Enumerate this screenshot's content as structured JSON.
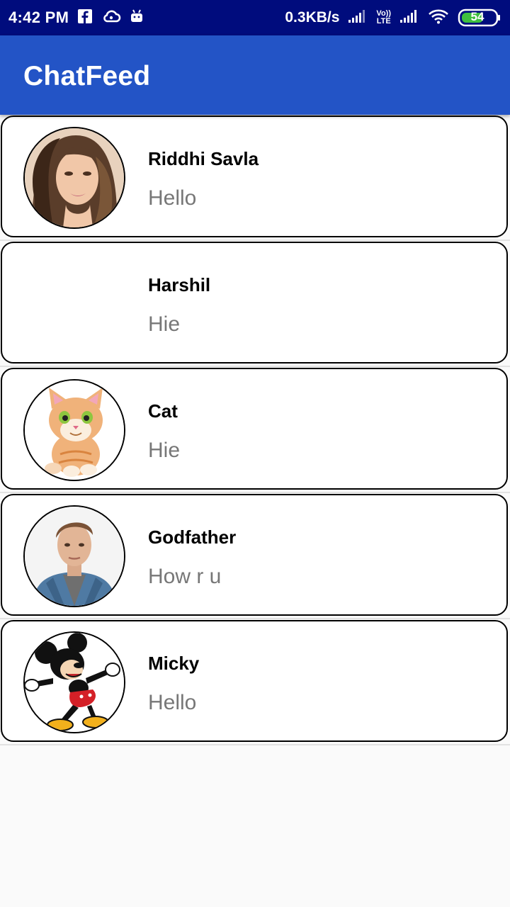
{
  "status_bar": {
    "time": "4:42 PM",
    "net_speed": "0.3KB/s",
    "volte_top": "Vo))",
    "volte_bottom": "LTE",
    "battery": "54",
    "icons": [
      "facebook-icon",
      "cloud-icon",
      "android-icon",
      "signal-icon",
      "volte-icon",
      "signal-icon",
      "wifi-icon",
      "battery-icon"
    ]
  },
  "app_bar": {
    "title": "ChatFeed"
  },
  "chats": [
    {
      "name": "Riddhi Savla",
      "message": "Hello",
      "avatar": "woman-portrait"
    },
    {
      "name": "Harshil",
      "message": "Hie",
      "avatar": "none"
    },
    {
      "name": "Cat",
      "message": "Hie",
      "avatar": "cartoon-cat"
    },
    {
      "name": "Godfather",
      "message": "How r u",
      "avatar": "man-portrait"
    },
    {
      "name": "Micky",
      "message": "Hello",
      "avatar": "mickey-mouse"
    }
  ],
  "colors": {
    "status_bar": "#000c7d",
    "app_bar": "#2354c6",
    "background": "#fafafa",
    "message_text": "#777777",
    "battery_fill": "#3fbf3f"
  }
}
